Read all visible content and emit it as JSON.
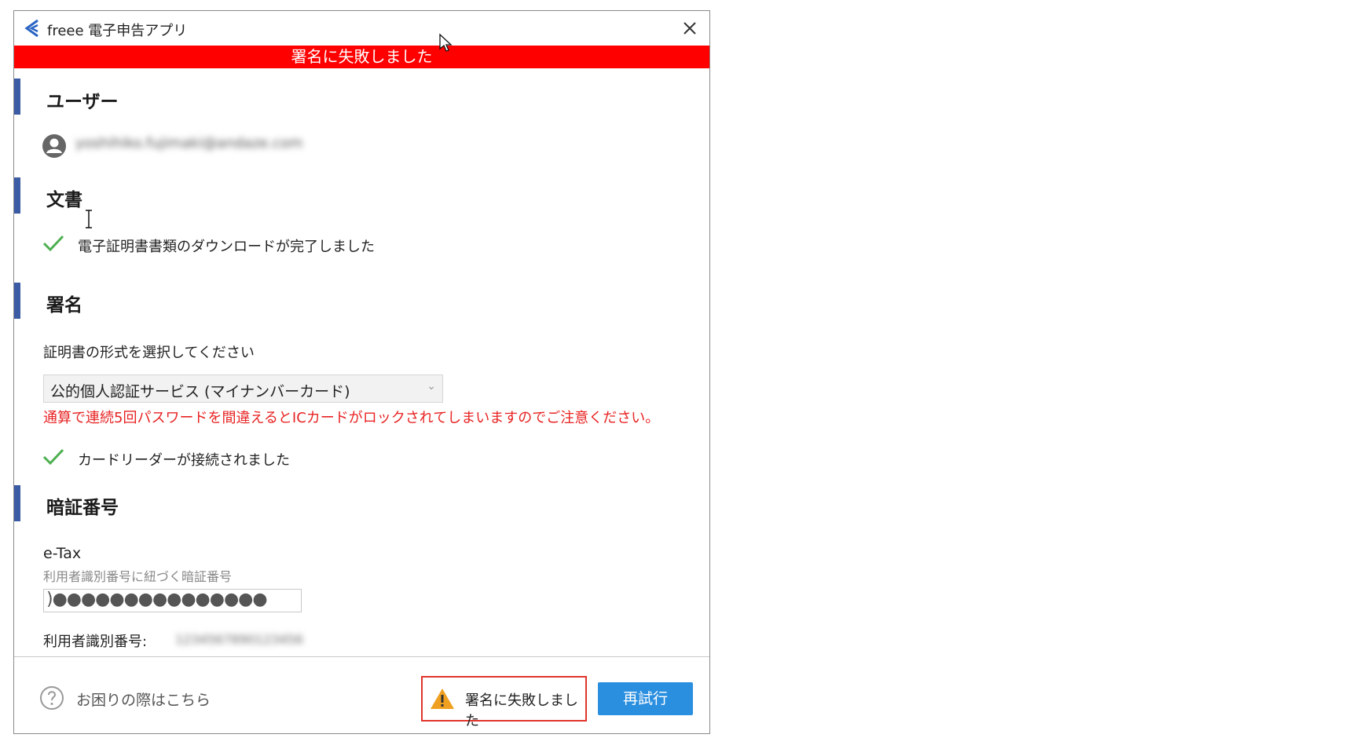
{
  "window": {
    "title": "freee 電子申告アプリ",
    "close_icon": "close-icon"
  },
  "banner": {
    "text": "署名に失敗しました",
    "color": "#ff0000"
  },
  "sections": {
    "user": {
      "title": "ユーザー",
      "email": "yoshihiko.fujimaki@andaze.com"
    },
    "document": {
      "title": "文書",
      "status": "電子証明書書類のダウンロードが完了しました"
    },
    "signature": {
      "title": "署名",
      "prompt": "証明書の形式を選択してください",
      "selected": "公的個人認証サービス (マイナンバーカード)",
      "warning": "通算で連続5回パスワードを間違えるとICカードがロックされてしまいますのでご注意ください。",
      "reader_status": "カードリーダーが接続されました"
    },
    "pin": {
      "title": "暗証番号",
      "label": "e-Tax",
      "sublabel": "利用者識別番号に紐づく暗証番号",
      "value": ")●●●●●●●●●●●●●●●",
      "userid_label": "利用者識別番号:",
      "userid_value": "1234567890123456"
    }
  },
  "footer": {
    "help_text": "お困りの際はこちら",
    "status_text": "署名に失敗しました",
    "retry_label": "再試行"
  },
  "colors": {
    "accent": "#2b8fe0",
    "section_bar": "#3b5ba5",
    "error": "#e82323",
    "success": "#4caf50",
    "warning": "#f0a020"
  }
}
